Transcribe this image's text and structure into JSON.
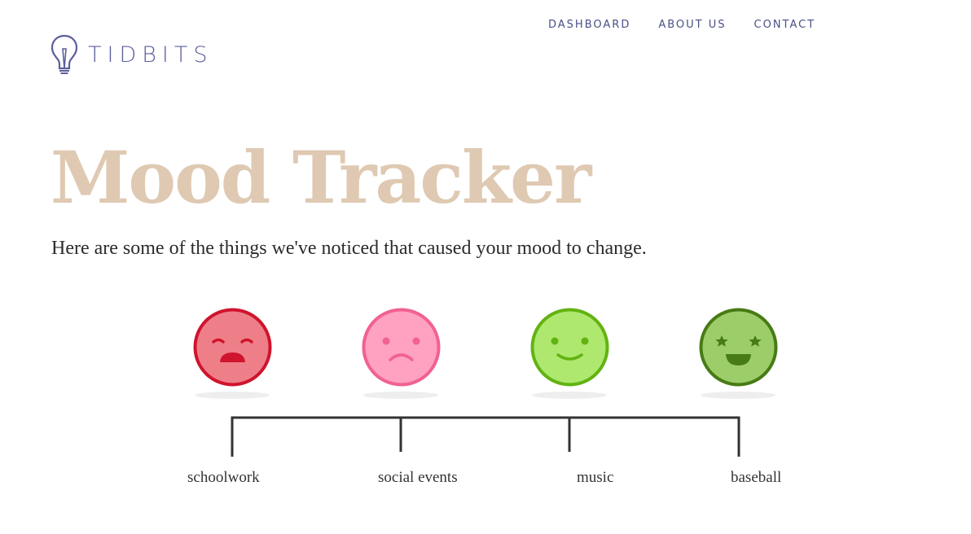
{
  "brand": {
    "name": "TIDBITS",
    "icon": "lightbulb-icon",
    "color": "#5b5f9b"
  },
  "nav": {
    "items": [
      {
        "label": "DASHBOARD"
      },
      {
        "label": "ABOUT US"
      },
      {
        "label": "CONTACT"
      }
    ]
  },
  "hero": {
    "title": "Mood Tracker",
    "title_color": "#dfc9b2",
    "subtitle": "Here are some of the things we've noticed that caused your mood to change."
  },
  "moods": [
    {
      "category": "schoolwork",
      "face": "crying-face-icon",
      "color": "#ee7f88",
      "border": "#d0142e"
    },
    {
      "category": "social events",
      "face": "sad-face-icon",
      "color": "#ffa1c0",
      "border": "#f16191"
    },
    {
      "category": "music",
      "face": "smiling-face-icon",
      "color": "#aee86e",
      "border": "#62b312"
    },
    {
      "category": "baseball",
      "face": "star-eyes-face-icon",
      "color": "#9dcd69",
      "border": "#477b16"
    }
  ]
}
